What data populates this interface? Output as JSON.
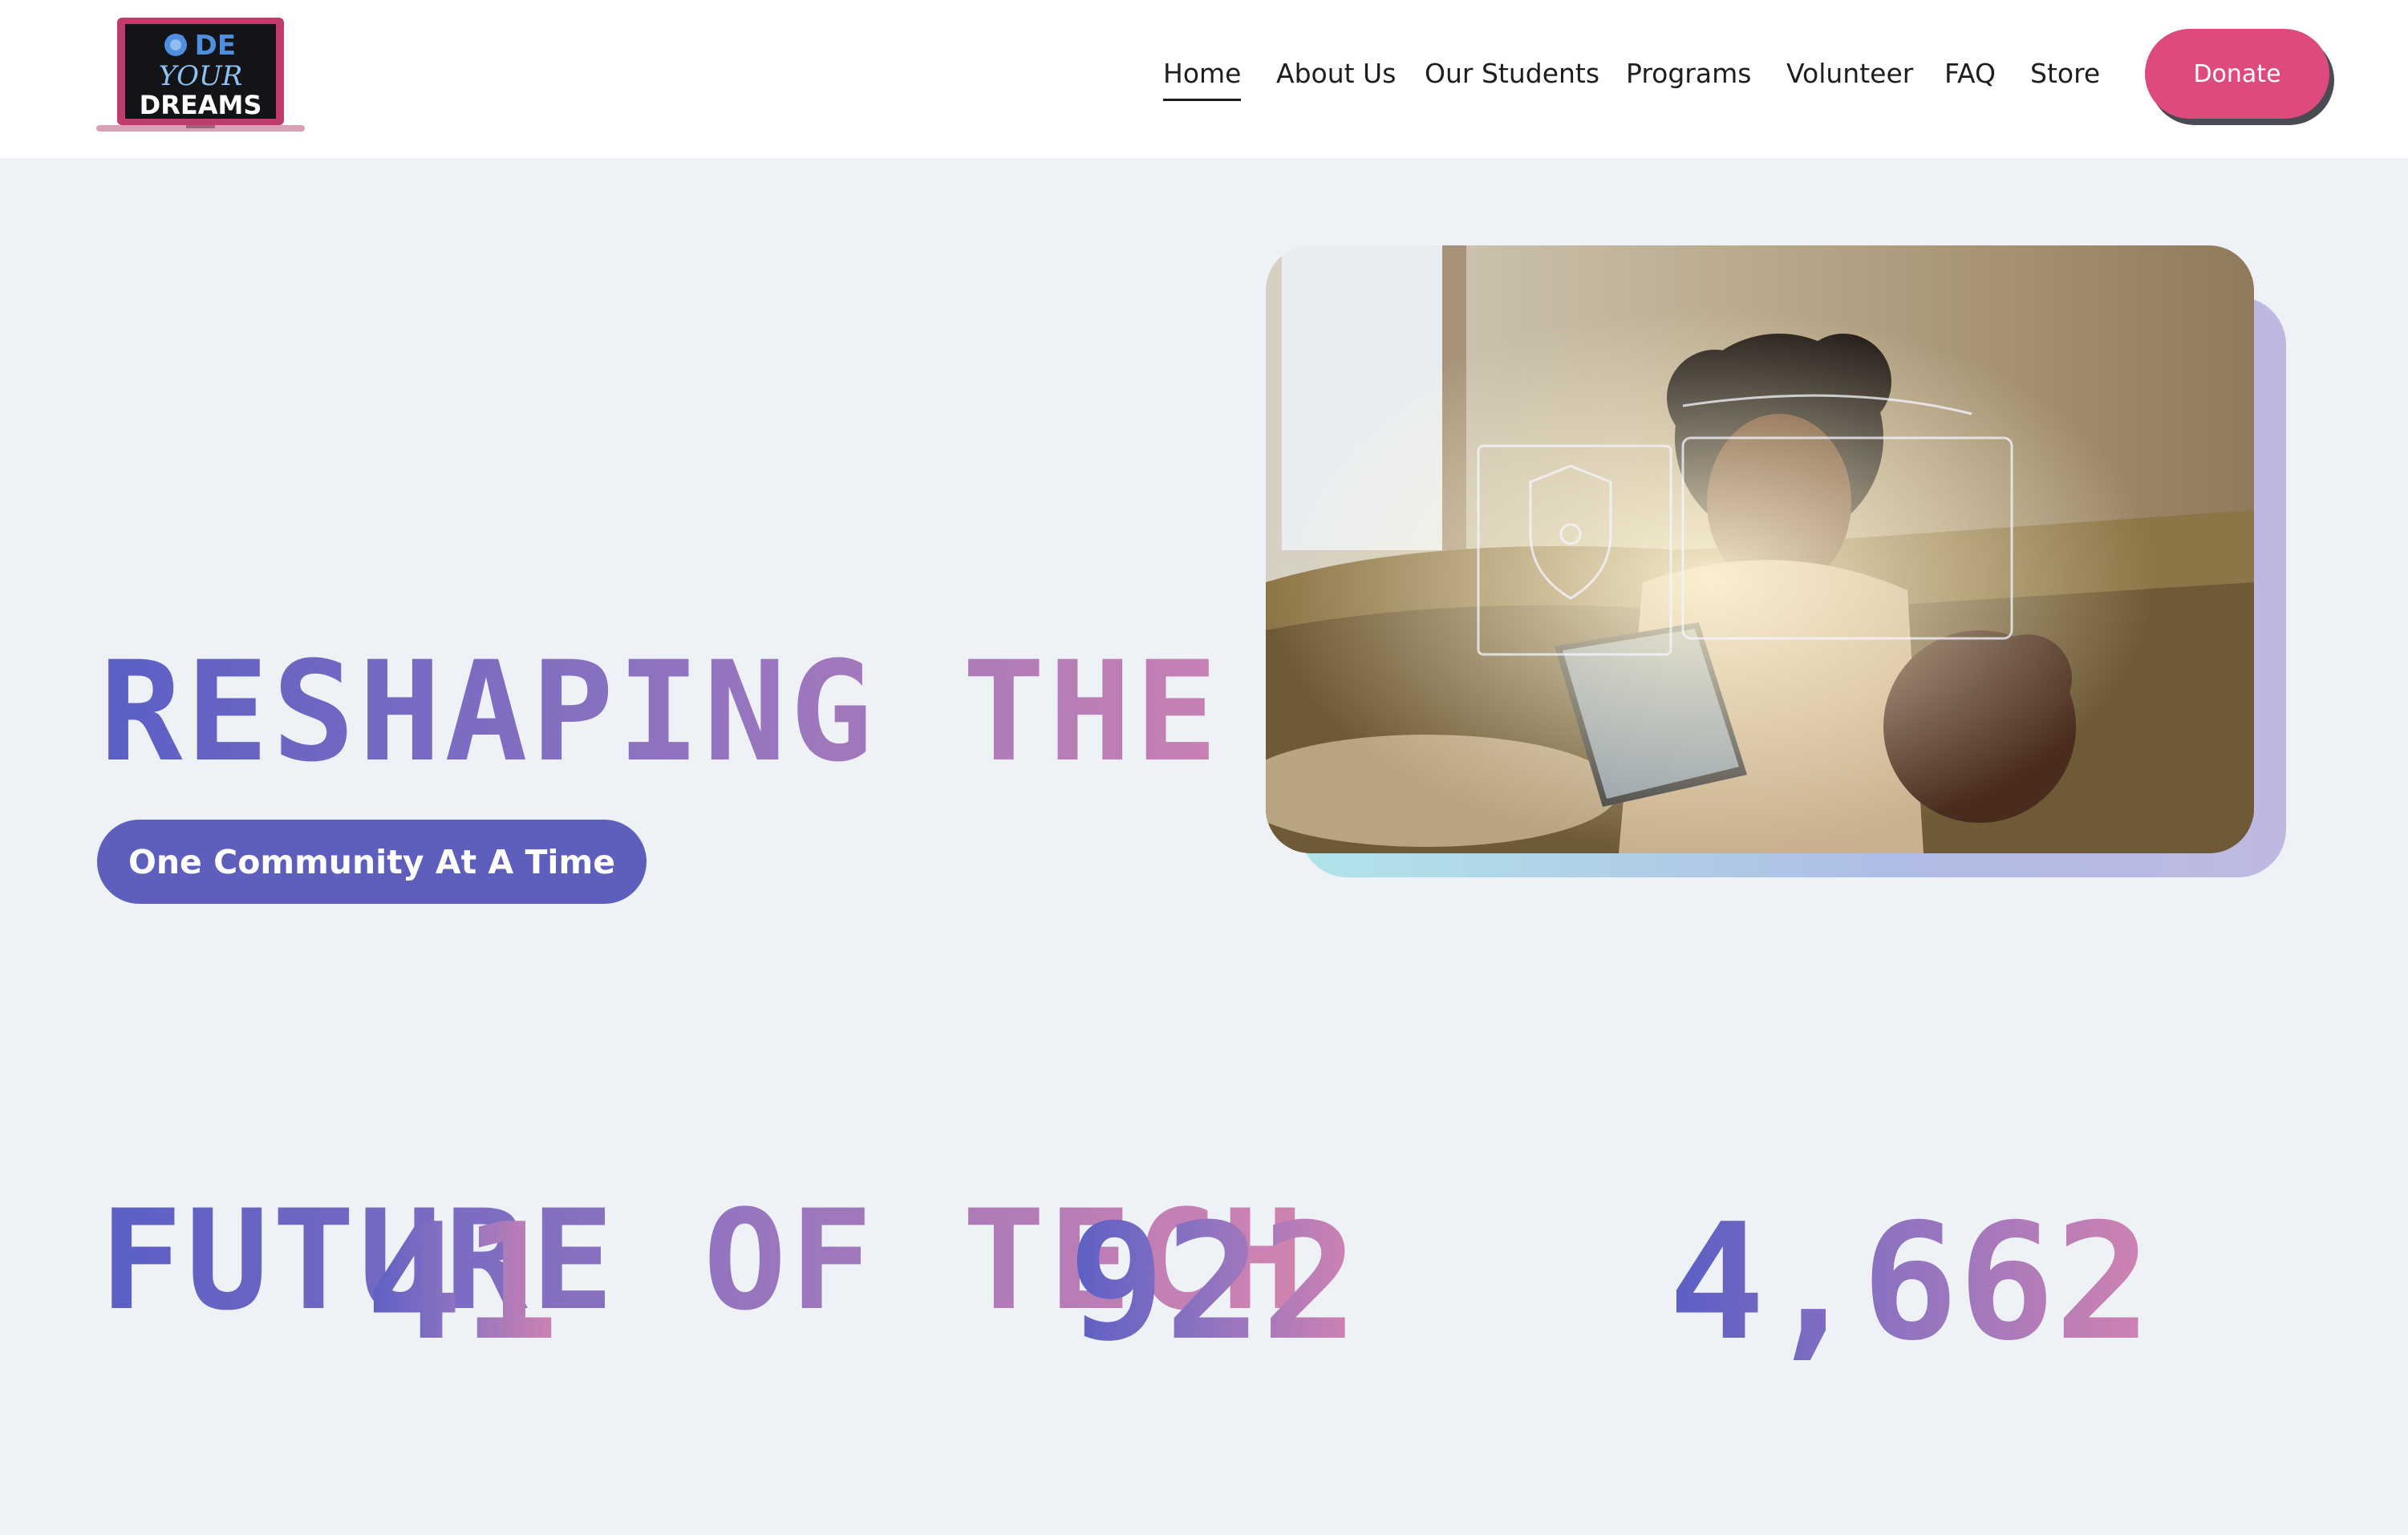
{
  "header": {
    "logo": {
      "alt": "CODE YOUR DREAMS",
      "line1": "C DE",
      "line2": "YOUR",
      "line3": "DREAMS"
    },
    "nav": [
      {
        "label": "Home",
        "active": true
      },
      {
        "label": "About Us",
        "active": false
      },
      {
        "label": "Our Students",
        "active": false
      },
      {
        "label": "Programs",
        "active": false
      },
      {
        "label": "Volunteer",
        "active": false
      },
      {
        "label": "FAQ",
        "active": false
      },
      {
        "label": "Store",
        "active": false
      }
    ],
    "donate_label": "Donate"
  },
  "hero": {
    "title_line1": "RESHAPING THE",
    "title_line2": "FUTURE OF TECH",
    "cta_label": "One Community At A Time"
  },
  "stats": [
    {
      "value": "41"
    },
    {
      "value": "922"
    },
    {
      "value": "4,662"
    }
  ],
  "colors": {
    "accent_pink": "#de4a7e",
    "accent_purple": "#5e5fbd",
    "gradient_start": "#5a5fc4",
    "gradient_end": "#d183b0",
    "background": "#eef2f6"
  }
}
